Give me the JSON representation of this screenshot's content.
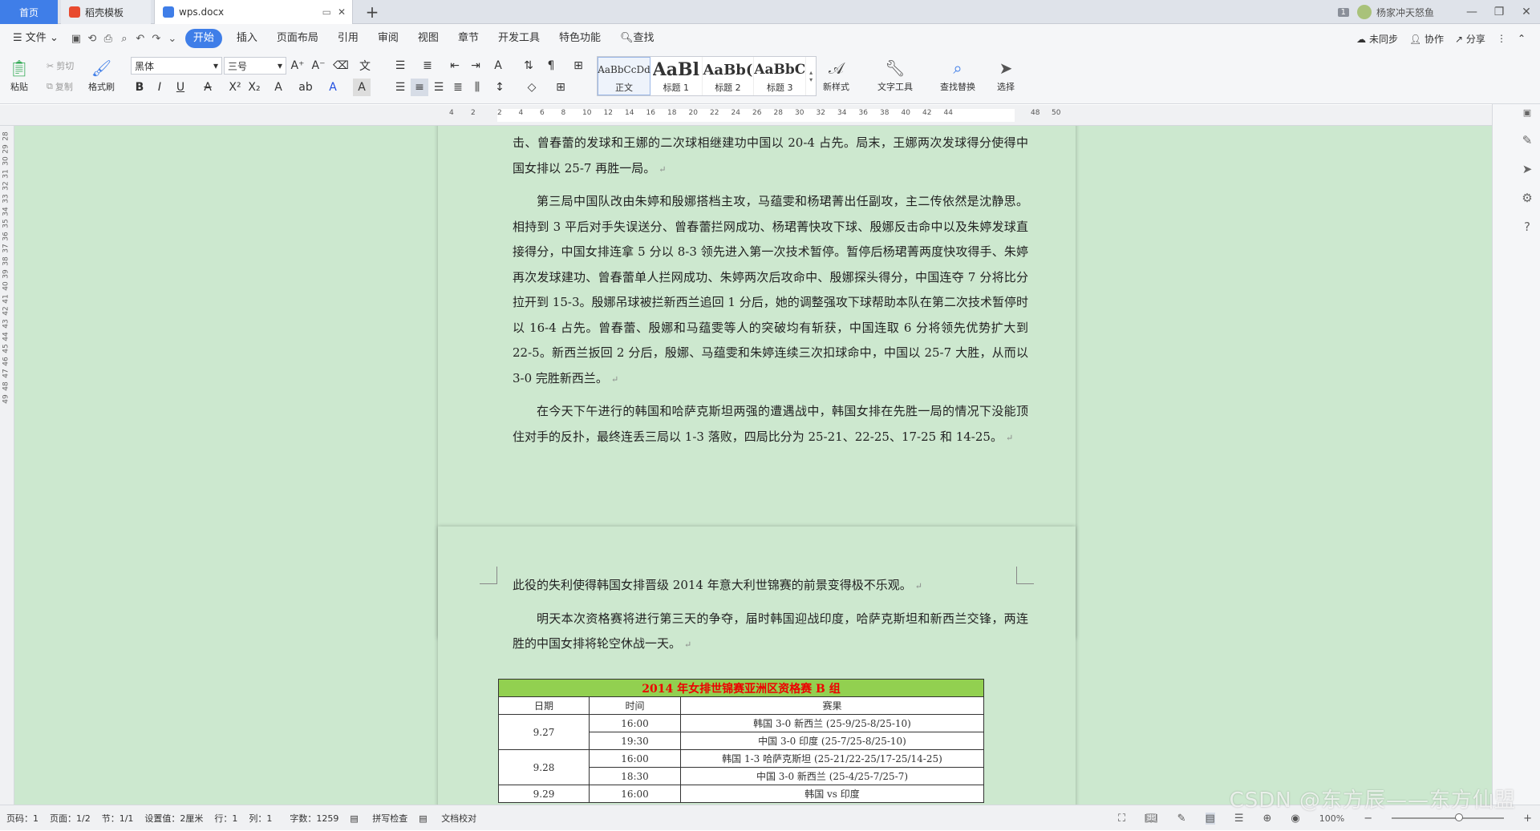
{
  "tabs": {
    "home": "首页",
    "template": "稻壳模板",
    "doc": "wps.docx",
    "badge": "1",
    "user": "杨家冲天怒鱼"
  },
  "menu": {
    "file": "文件",
    "items": [
      "开始",
      "插入",
      "页面布局",
      "引用",
      "审阅",
      "视图",
      "章节",
      "开发工具",
      "特色功能"
    ],
    "search": "查找",
    "unsynced": "未同步",
    "collab": "协作",
    "share": "分享"
  },
  "toolbar": {
    "paste": "粘贴",
    "cut": "剪切",
    "copy": "复制",
    "format_painter": "格式刷",
    "font": "黑体",
    "size": "三号",
    "styles": [
      {
        "preview": "AaBbCcDd",
        "label": "正文"
      },
      {
        "preview": "AaBl",
        "label": "标题 1"
      },
      {
        "preview": "AaBb(",
        "label": "标题 2"
      },
      {
        "preview": "AaBbC",
        "label": "标题 3"
      }
    ],
    "new_style": "新样式",
    "text_tools": "文字工具",
    "find_replace": "查找替换",
    "select": "选择"
  },
  "ruler": [
    "4",
    "2",
    "2",
    "4",
    "6",
    "8",
    "10",
    "12",
    "14",
    "16",
    "18",
    "20",
    "22",
    "24",
    "26",
    "28",
    "30",
    "32",
    "34",
    "36",
    "38",
    "40",
    "42",
    "44",
    "48",
    "50"
  ],
  "vruler": [
    "28",
    "29",
    "30",
    "31",
    "32",
    "33",
    "34",
    "35",
    "36",
    "37",
    "38",
    "39",
    "40",
    "41",
    "42",
    "43",
    "44",
    "45",
    "46",
    "47",
    "48",
    "49"
  ],
  "page1": [
    {
      "text": "击、曾春蕾的发球和王娜的二次球相继建功中国以 20-4 占先。局末，王娜两次发球得分使得中国女排以 25-7 再胜一局。",
      "indent": false
    },
    {
      "text": "第三局中国队改由朱婷和殷娜搭档主攻，马蕴雯和杨珺菁出任副攻，主二传依然是沈静思。相持到 3 平后对手失误送分、曾春蕾拦网成功、杨珺菁快攻下球、殷娜反击命中以及朱婷发球直接得分，中国女排连拿 5 分以 8-3 领先进入第一次技术暂停。暂停后杨珺菁两度快攻得手、朱婷再次发球建功、曾春蕾单人拦网成功、朱婷两次后攻命中、殷娜探头得分，中国连夺 7 分将比分拉开到 15-3。殷娜吊球被拦新西兰追回 1 分后，她的调整强攻下球帮助本队在第二次技术暂停时以 16-4 占先。曾春蕾、殷娜和马蕴雯等人的突破均有斩获，中国连取 6 分将领先优势扩大到 22-5。新西兰扳回 2 分后，殷娜、马蕴雯和朱婷连续三次扣球命中，中国以 25-7 大胜，从而以 3-0 完胜新西兰。",
      "indent": true
    },
    {
      "text": "在今天下午进行的韩国和哈萨克斯坦两强的遭遇战中，韩国女排在先胜一局的情况下没能顶住对手的反扑，最终连丢三局以 1-3 落败，四局比分为 25-21、22-25、17-25 和 14-25。",
      "indent": true
    }
  ],
  "page2": [
    {
      "text": "此役的失利使得韩国女排晋级 2014 年意大利世锦赛的前景变得极不乐观。",
      "indent": false
    },
    {
      "text": "明天本次资格赛将进行第三天的争夺，届时韩国迎战印度，哈萨克斯坦和新西兰交锋，两连胜的中国女排将轮空休战一天。",
      "indent": true
    }
  ],
  "table": {
    "title": "2014 年女排世锦赛亚洲区资格赛 B 组",
    "headers": [
      "日期",
      "时间",
      "赛果"
    ],
    "rows": [
      {
        "date": "9.27",
        "time": "16:00",
        "result": "韩国 3-0 新西兰 (25-9/25-8/25-10)"
      },
      {
        "date": "",
        "time": "19:30",
        "result": "中国 3-0 印度 (25-7/25-8/25-10)"
      },
      {
        "date": "9.28",
        "time": "16:00",
        "result": "韩国 1-3 哈萨克斯坦 (25-21/22-25/17-25/14-25)"
      },
      {
        "date": "",
        "time": "18:30",
        "result": "中国 3-0 新西兰 (25-4/25-7/25-7)"
      },
      {
        "date": "9.29",
        "time": "16:00",
        "result": "韩国 vs 印度"
      }
    ]
  },
  "status": {
    "page_num": "页码：1",
    "pages": "页面：1/2",
    "section": "节：1/1",
    "setting": "设置值：2厘米",
    "row": "行：1",
    "col": "列：1",
    "words": "字数：1259",
    "spell": "拼写检查",
    "proof": "文档校对",
    "zoom": "100%"
  },
  "watermark": "CSDN @东方辰——东方仙盟",
  "colors": {
    "accent": "#3f7ee8",
    "page_bg": "#cce8cf",
    "table_header": "#92d050",
    "table_title": "#e00000"
  }
}
